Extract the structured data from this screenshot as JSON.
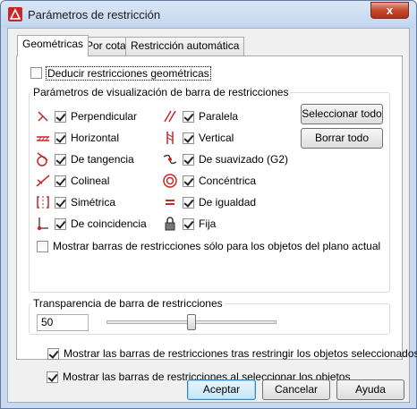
{
  "window": {
    "title": "Parámetros de restricción",
    "close_glyph": "x"
  },
  "tabs": [
    {
      "label": "Geométricas",
      "active": true
    },
    {
      "label": "Por cota",
      "active": false
    },
    {
      "label": "Restricción automática",
      "active": false
    }
  ],
  "infer": {
    "label": "Deducir restricciones geométricas",
    "checked": false
  },
  "display_group": {
    "title": "Parámetros de visualización de barra de restricciones",
    "left_items": [
      {
        "label": "Perpendicular",
        "checked": true,
        "icon": "perpendicular-icon"
      },
      {
        "label": "Horizontal",
        "checked": true,
        "icon": "horizontal-icon"
      },
      {
        "label": "De tangencia",
        "checked": true,
        "icon": "tangent-icon"
      },
      {
        "label": "Colineal",
        "checked": true,
        "icon": "collinear-icon"
      },
      {
        "label": "Simétrica",
        "checked": true,
        "icon": "symmetric-icon"
      },
      {
        "label": "De coincidencia",
        "checked": true,
        "icon": "coincident-icon"
      }
    ],
    "right_items": [
      {
        "label": "Paralela",
        "checked": true,
        "icon": "parallel-icon"
      },
      {
        "label": "Vertical",
        "checked": true,
        "icon": "vertical-icon"
      },
      {
        "label": "De suavizado (G2)",
        "checked": true,
        "icon": "smooth-icon"
      },
      {
        "label": "Concéntrica",
        "checked": true,
        "icon": "concentric-icon"
      },
      {
        "label": "De igualdad",
        "checked": true,
        "icon": "equal-icon"
      },
      {
        "label": "Fija",
        "checked": true,
        "icon": "lock-icon"
      }
    ],
    "select_all_label": "Seleccionar todo",
    "clear_all_label": "Borrar todo",
    "plan_only": {
      "label": "Mostrar barras de restricciones sólo para los objetos del plano actual",
      "checked": false
    }
  },
  "transparency": {
    "title": "Transparencia de barra de restricciones",
    "value": "50",
    "slider_level_percent": 50
  },
  "show_after_apply": {
    "label": "Mostrar las barras de restricciones tras restringir los objetos seleccionados",
    "checked": true
  },
  "show_on_select": {
    "label": "Mostrar las barras de restricciones al seleccionar los objetos",
    "checked": true
  },
  "buttons": {
    "ok": "Aceptar",
    "cancel": "Cancelar",
    "help": "Ayuda"
  },
  "colors": {
    "icon_red": "#c62828",
    "titlebar": "#c9daf0"
  }
}
